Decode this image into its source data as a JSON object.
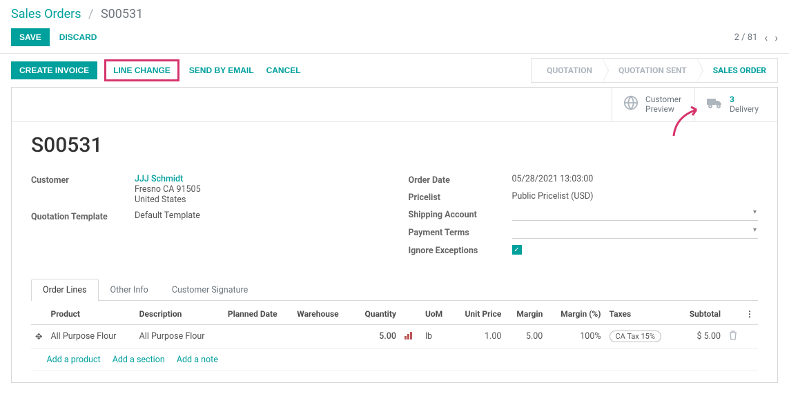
{
  "breadcrumb": {
    "root": "Sales Orders",
    "current": "S00531"
  },
  "topbar": {
    "save": "SAVE",
    "discard": "DISCARD"
  },
  "pager": {
    "text": "2 / 81"
  },
  "actions": {
    "create_invoice": "CREATE INVOICE",
    "line_change": "LINE CHANGE",
    "send_email": "SEND BY EMAIL",
    "cancel": "CANCEL"
  },
  "status_steps": {
    "quotation": "QUOTATION",
    "quotation_sent": "QUOTATION SENT",
    "sales_order": "SALES ORDER"
  },
  "stat_buttons": {
    "customer_preview": {
      "line1": "Customer",
      "line2": "Preview"
    },
    "delivery": {
      "count": "3",
      "label": "Delivery"
    }
  },
  "order": {
    "name": "S00531"
  },
  "left_fields": {
    "customer_label": "Customer",
    "customer_name": "JJJ Schmidt",
    "customer_addr1": "Fresno CA 91505",
    "customer_addr2": "United States",
    "quotation_template_label": "Quotation Template",
    "quotation_template_value": "Default Template"
  },
  "right_fields": {
    "order_date_label": "Order Date",
    "order_date_value": "05/28/2021 13:03:00",
    "pricelist_label": "Pricelist",
    "pricelist_value": "Public Pricelist (USD)",
    "shipping_account_label": "Shipping Account",
    "payment_terms_label": "Payment Terms",
    "ignore_exceptions_label": "Ignore Exceptions"
  },
  "tabs": {
    "order_lines": "Order Lines",
    "other_info": "Other Info",
    "customer_signature": "Customer Signature"
  },
  "columns": {
    "product": "Product",
    "description": "Description",
    "planned_date": "Planned Date",
    "warehouse": "Warehouse",
    "quantity": "Quantity",
    "uom": "UoM",
    "unit_price": "Unit Price",
    "margin": "Margin",
    "margin_pct": "Margin (%)",
    "taxes": "Taxes",
    "subtotal": "Subtotal"
  },
  "row": {
    "product": "All Purpose Flour",
    "description": "All Purpose Flour",
    "quantity": "5.00",
    "uom": "lb",
    "unit_price": "1.00",
    "margin": "5.00",
    "margin_pct": "100%",
    "tax": "CA Tax 15%",
    "subtotal": "$ 5.00"
  },
  "add_links": {
    "product": "Add a product",
    "section": "Add a section",
    "note": "Add a note"
  }
}
